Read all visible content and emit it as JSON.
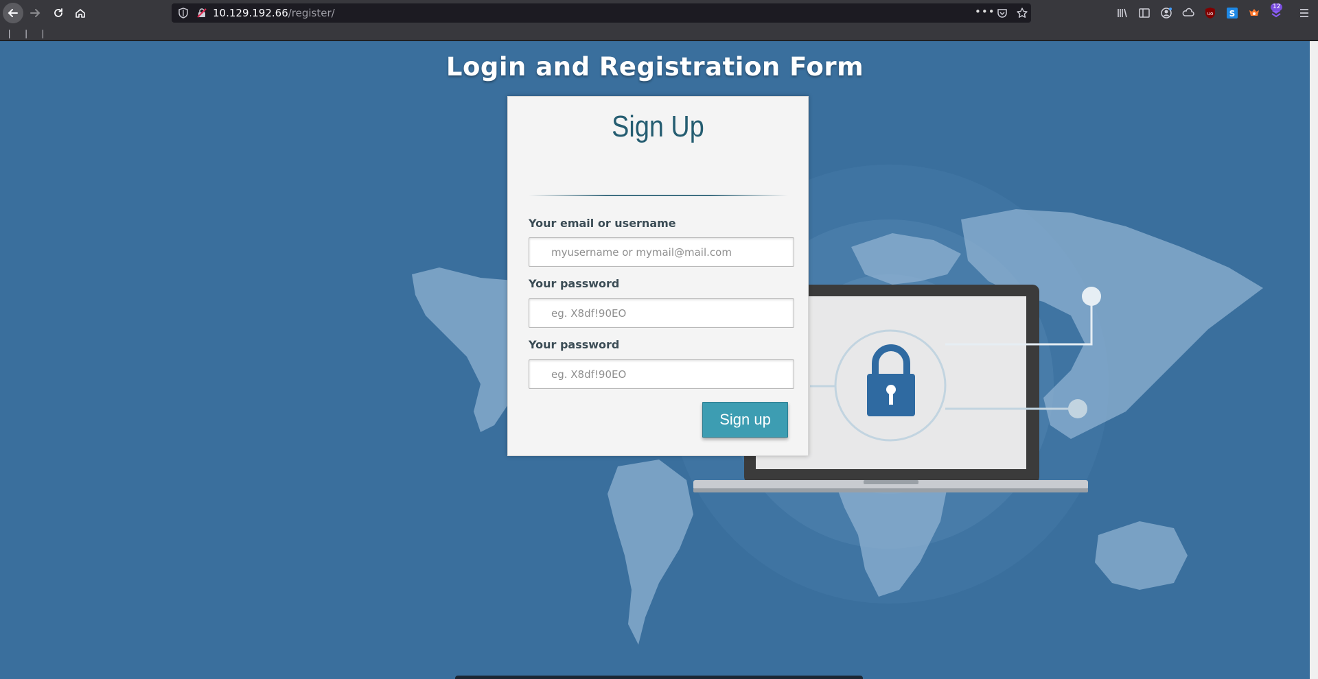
{
  "browser": {
    "url_host": "10.129.192.66",
    "url_path": "/register/",
    "url_menu_dots": "•••",
    "extension_badge": "12",
    "bookmarks_marks": "| | |"
  },
  "page": {
    "title": "Login and Registration Form"
  },
  "form": {
    "heading": "Sign Up",
    "email_label": "Your email or username",
    "email_placeholder": "myusername or mymail@mail.com",
    "password_label": "Your password",
    "password_placeholder": "eg. X8df!90EO",
    "confirm_label": "Your password",
    "confirm_placeholder": "eg. X8df!90EO",
    "submit_label": "Sign up"
  },
  "colors": {
    "page_background": "#3a6f9d",
    "card_background": "#f4f4f4",
    "heading_color": "#255d71",
    "button_color": "#3d9db2"
  }
}
